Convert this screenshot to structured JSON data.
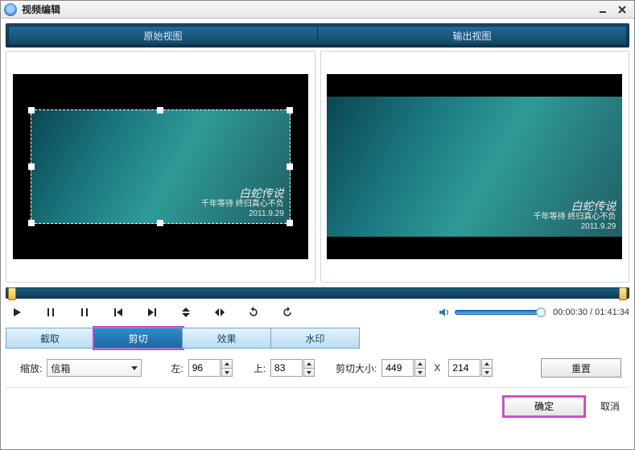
{
  "window": {
    "title": "视频编辑"
  },
  "views": {
    "original": "原始视图",
    "output": "输出视图"
  },
  "watermark": {
    "title": "白蛇传说",
    "sub1": "千年等待 终归真心不负",
    "sub2": "2011.9.29"
  },
  "time": {
    "current": "00:00:30",
    "total": "01:41:34"
  },
  "tabs": {
    "clip": "截取",
    "crop": "剪切",
    "effect": "效果",
    "watermark": "水印"
  },
  "form": {
    "zoom_label": "缩放:",
    "zoom_value": "信箱",
    "left_label": "左:",
    "left_value": "96",
    "top_label": "上:",
    "top_value": "83",
    "cropsize_label": "剪切大小:",
    "crop_w": "449",
    "crop_x_sep": "X",
    "crop_h": "214",
    "reset": "重置"
  },
  "footer": {
    "ok": "确定",
    "cancel": "取消"
  }
}
